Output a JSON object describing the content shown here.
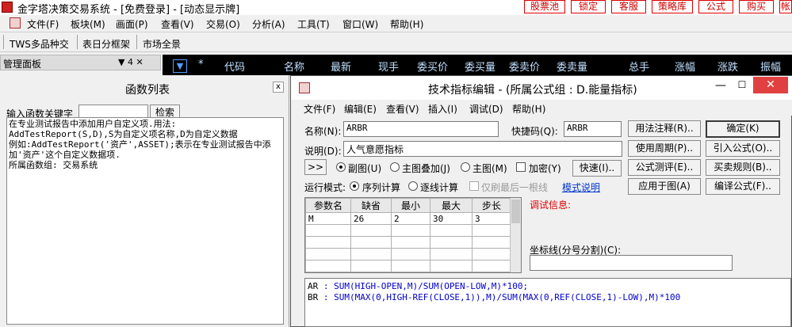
{
  "titlebar": {
    "title": "金字塔决策交易系统 - [免费登录] - [动态显示牌]",
    "buttons": [
      "股票池",
      "锁定",
      "客服",
      "策略库",
      "公式",
      "购买",
      "帐"
    ]
  },
  "menubar": {
    "items": [
      "文件(F)",
      "板块(M)",
      "画面(P)",
      "查看(V)",
      "交易(O)",
      "分析(A)",
      "工具(T)",
      "窗口(W)",
      "帮助(H)"
    ]
  },
  "toolbar": {
    "tabs": [
      "TWS多品种交",
      "表日分框架",
      "市场全景"
    ]
  },
  "left": {
    "mgmt_title": "管理面板",
    "mgmt_controls": "▼ 4 ✕",
    "fn_title": "函数列表",
    "fn_close": "x",
    "search_label": "输入函数关键字",
    "search_value": "",
    "search_btn": "检索",
    "desc_text": "在专业测试报告中添加用户自定义项.用法:\nAddTestReport(S,D),S为自定义项名称,D为自定义数据\n例如:AddTestReport('资产',ASSET);表示在专业测试报告中添\n加'资产'这个自定义数据项.\n所属函数组: 交易系统"
  },
  "quote_header": {
    "dropdown": "▼",
    "star": "*",
    "columns": [
      "代码",
      "名称",
      "最新",
      "现手",
      "委买价",
      "委买量",
      "委卖价",
      "委卖量",
      "总手",
      "涨幅",
      "涨跌",
      "振幅"
    ]
  },
  "dialog": {
    "title": "技术指标编辑 - (所属公式组 : D.能量指标)",
    "menu": [
      "文件(F)",
      "编辑(E)",
      "查看(V)",
      "插入(I)",
      "调试(D)",
      "帮助(H)"
    ],
    "name_label": "名称(N):",
    "name_value": "ARBR",
    "hotkey_label": "快捷码(Q):",
    "hotkey_value": "ARBR",
    "desc_label": "说明(D):",
    "desc_value": "人气意愿指标",
    "expand_btn": ">>",
    "chart_modes": [
      "副图(U)",
      "主图叠加(J)",
      "主图(M)"
    ],
    "encrypt_label": "加密(Y)",
    "quick_btn": "快速(I)..",
    "run_mode_label": "运行模式:",
    "run_modes": [
      "序列计算",
      "逐线计算"
    ],
    "last_bar_label": "仅刷最后一根线",
    "mode_help": "模式说明",
    "mid_buttons": [
      "用法注释(R)..",
      "使用周期(P)..",
      "公式测评(E)..",
      "应用于图(A)"
    ],
    "right_buttons": [
      "确定(K)",
      "引入公式(O)..",
      "买卖规则(B)..",
      "编译公式(F).."
    ],
    "params_headers": [
      "参数名",
      "缺省",
      "最小",
      "最大",
      "步长"
    ],
    "params_rows": [
      [
        "M",
        "26",
        "2",
        "30",
        "3"
      ]
    ],
    "debug_label": "调试信息:",
    "axis_label": "坐标线(分号分割)(C):",
    "axis_value": "",
    "code_lines": [
      {
        "var": "AR",
        "expr": " : SUM(HIGH-OPEN,M)/SUM(OPEN-LOW,M)*100;"
      },
      {
        "var": "BR",
        "expr": " : SUM(MAX(0,HIGH-REF(CLOSE,1)),M)/SUM(MAX(0,REF(CLOSE,1)-LOW),M)*100"
      }
    ]
  },
  "colors": {
    "quote_bg": "#000000",
    "quote_text": "#c0e0ff",
    "accent_red": "#cc0000",
    "debug_red": "#e00000"
  }
}
